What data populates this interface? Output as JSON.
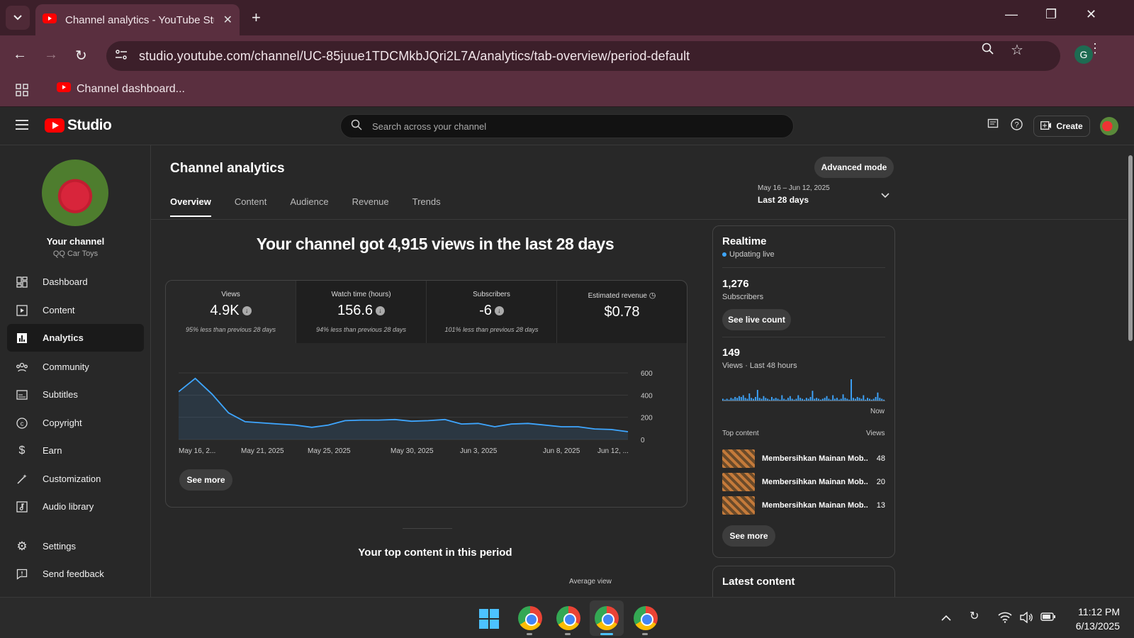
{
  "browser": {
    "tab_title": "Channel analytics - YouTube Studio",
    "url": "studio.youtube.com/channel/UC-85juue1TDCMkbJQri2L7A/analytics/tab-overview/period-default",
    "bookmark": "Channel dashboard...",
    "profile_initial": "G"
  },
  "studio": {
    "logo_text": "Studio",
    "search_placeholder": "Search across your channel",
    "create_label": "Create"
  },
  "sidebar": {
    "channel_title": "Your channel",
    "channel_name": "QQ Car Toys",
    "items": [
      {
        "label": "Dashboard",
        "icon": "dashboard-icon"
      },
      {
        "label": "Content",
        "icon": "content-icon"
      },
      {
        "label": "Analytics",
        "icon": "analytics-icon",
        "active": true
      },
      {
        "label": "Community",
        "icon": "community-icon"
      },
      {
        "label": "Subtitles",
        "icon": "subtitles-icon"
      },
      {
        "label": "Copyright",
        "icon": "copyright-icon"
      },
      {
        "label": "Earn",
        "icon": "earn-icon"
      },
      {
        "label": "Customization",
        "icon": "customization-icon"
      },
      {
        "label": "Audio library",
        "icon": "audio-library-icon"
      }
    ],
    "settings_label": "Settings",
    "feedback_label": "Send feedback"
  },
  "main": {
    "title": "Channel analytics",
    "advanced_mode": "Advanced mode",
    "tabs": [
      "Overview",
      "Content",
      "Audience",
      "Revenue",
      "Trends"
    ],
    "period_range": "May 16 – Jun 12, 2025",
    "period_label": "Last 28 days",
    "headline": "Your channel got 4,915 views in the last 28 days",
    "metrics": [
      {
        "label": "Views",
        "value": "4.9K",
        "note": "95% less than previous 28 days"
      },
      {
        "label": "Watch time (hours)",
        "value": "156.6",
        "note": "94% less than previous 28 days"
      },
      {
        "label": "Subscribers",
        "value": "-6",
        "note": "101% less than previous 28 days"
      },
      {
        "label": "Estimated revenue",
        "value": "$0.78",
        "note": ""
      }
    ],
    "see_more": "See more",
    "top_content_title": "Your top content in this period",
    "avg_view": "Average view"
  },
  "chart_data": {
    "type": "area",
    "series": [
      {
        "values": [
          430,
          550,
          410,
          240,
          160,
          150,
          140,
          130,
          110,
          130,
          170,
          175,
          175,
          180,
          165,
          170,
          180,
          140,
          145,
          115,
          140,
          145,
          130,
          115,
          115,
          95,
          90,
          70
        ]
      }
    ],
    "x_tick_labels": [
      "May 16, 2...",
      "May 21, 2025",
      "May 25, 2025",
      "May 30, 2025",
      "Jun 3, 2025",
      "Jun 8, 2025",
      "Jun 12, ..."
    ],
    "y_ticks": [
      "600",
      "400",
      "200",
      "0"
    ],
    "ylim": [
      0,
      600
    ],
    "color": "#3ea6ff"
  },
  "realtime": {
    "title": "Realtime",
    "live": "Updating live",
    "subscribers_value": "1,276",
    "subscribers_label": "Subscribers",
    "see_live_count": "See live count",
    "views_value": "149",
    "views_label": "Views · Last 48 hours",
    "bars": [
      2,
      1,
      2,
      1,
      3,
      2,
      4,
      3,
      5,
      4,
      6,
      3,
      2,
      8,
      3,
      2,
      4,
      12,
      3,
      2,
      5,
      3,
      2,
      1,
      4,
      2,
      3,
      2,
      1,
      6,
      2,
      1,
      3,
      5,
      2,
      1,
      2,
      6,
      3,
      2,
      1,
      3,
      2,
      4,
      11,
      2,
      3,
      2,
      1,
      2,
      3,
      5,
      2,
      1,
      6,
      2,
      3,
      1,
      2,
      7,
      3,
      2,
      1,
      24,
      3,
      2,
      4,
      3,
      2,
      6,
      1,
      3,
      2,
      1,
      2,
      4,
      9,
      3,
      2,
      1
    ],
    "now": "Now",
    "top_content_label": "Top content",
    "views_col": "Views",
    "rows": [
      {
        "title": "Membersihkan Mainan Mob...",
        "views": "48"
      },
      {
        "title": "Membersihkan Mainan Mob...",
        "views": "20"
      },
      {
        "title": "Membersihkan Mainan Mob...",
        "views": "13"
      }
    ],
    "see_more": "See more",
    "latest_title": "Latest content"
  },
  "taskbar": {
    "time": "11:12 PM",
    "date": "6/13/2025"
  }
}
